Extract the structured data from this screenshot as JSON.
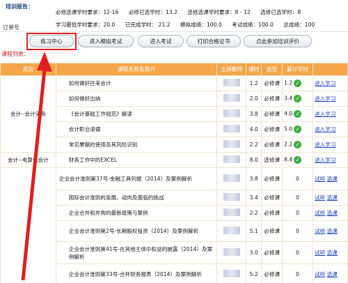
{
  "report": {
    "label": "培训报告：",
    "order_label": "订单号",
    "row1": [
      "必修选课学时要求：12-16",
      "必修已选学时：13.2",
      "选修选课学时要求：8 - 12",
      "选修已选学时：8"
    ],
    "row2": [
      "学习最低学时要求：20.0",
      "已完成学时： 21.2",
      "模拟成绩：100.0",
      "考试成绩：100.0",
      "总成绩：100"
    ]
  },
  "toolbar": [
    "练习中心",
    "进入模拟考试",
    "进入考试",
    "打印合格证书",
    "点此参加培训评价"
  ],
  "list_title": "课程列表：",
  "headers": [
    "类别",
    "课程名称及简介",
    "主讲教师",
    "课时",
    "类型",
    "累计学时"
  ],
  "colors": {
    "header": "#f3a64a",
    "link": "#1d3fb8",
    "highlight": "#e02020",
    "check": "#3fae3f"
  },
  "category_1": "会计--会计实务",
  "category_2": "会计--电算化会计",
  "courses": [
    {
      "name": "如何做好往来会计",
      "hours": "1.2",
      "type": "必修课",
      "acc": "1.2",
      "done": true,
      "action": "进入学习"
    },
    {
      "name": "如何做好出纳",
      "hours": "2.0",
      "type": "必修课",
      "acc": "3.4",
      "done": true,
      "action": "进入学习"
    },
    {
      "name": "《会计基础工作规范》解读",
      "hours": "3.8",
      "type": "必修课",
      "acc": "4.0",
      "done": true,
      "action": "进入学习"
    },
    {
      "name": "会计职业道德",
      "hours": "4.0",
      "type": "必修课",
      "acc": "5.0",
      "done": true,
      "action": "进入学习"
    },
    {
      "name": "常见票据的使用及其风险识别",
      "hours": "2.2",
      "type": "必修课",
      "acc": "2.2",
      "done": true,
      "action": "进入学习"
    },
    {
      "name": "财务工作中的EXCEL",
      "hours": "8.0",
      "type": "选修课",
      "acc": "8.4",
      "done": true,
      "action": "进入学习"
    },
    {
      "name": "企业会计准则第37号-金融工具列报（2014）及案例解析",
      "hours": "3.8",
      "type": "必修课",
      "acc": "0",
      "done": false,
      "action": "试听",
      "action2": "选课"
    },
    {
      "name": "国际会计准则的发展、动向及面临的挑战",
      "hours": "3.4",
      "type": "必修课",
      "acc": "0",
      "done": false,
      "action": "试听",
      "action2": "选课"
    },
    {
      "name": "企业合并和并购的最新政策与案例",
      "hours": "2.2",
      "type": "必修课",
      "acc": "0",
      "done": false,
      "action": "试听",
      "action2": "选课"
    },
    {
      "name": "企业会计准则第2号-长期股权投资（2014）及案例解析",
      "hours": "5.1",
      "type": "必修课",
      "acc": "0",
      "done": false,
      "action": "试听",
      "action2": "选课"
    },
    {
      "name": "企业会计准则第41号-在其他主体中权益的披露（2014）及案例解析",
      "hours": "3.0",
      "type": "必修课",
      "acc": "0",
      "done": false,
      "action": "试听",
      "action2": "选课"
    },
    {
      "name": "企业会计准则第33号-合并财务报表（2014）及案例解析",
      "hours": "5.2",
      "type": "必修课",
      "acc": "0",
      "done": false,
      "action": "试听",
      "action2": "选课"
    }
  ]
}
